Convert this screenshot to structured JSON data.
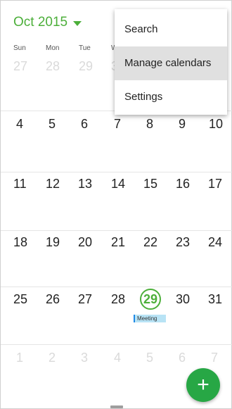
{
  "header": {
    "month": "Oct 2015"
  },
  "weekdays": [
    "Sun",
    "Mon",
    "Tue",
    "W"
  ],
  "weeks": [
    [
      "27",
      "28",
      "29",
      "3",
      "",
      "",
      ""
    ],
    [
      "4",
      "5",
      "6",
      "7",
      "8",
      "9",
      "10"
    ],
    [
      "11",
      "12",
      "13",
      "14",
      "15",
      "16",
      "17"
    ],
    [
      "18",
      "19",
      "20",
      "21",
      "22",
      "23",
      "24"
    ],
    [
      "25",
      "26",
      "27",
      "28",
      "29",
      "30",
      "31"
    ],
    [
      "1",
      "2",
      "3",
      "4",
      "5",
      "6",
      "7"
    ]
  ],
  "event": {
    "label": "Meeting"
  },
  "menu": {
    "items": [
      "Search",
      "Manage calendars",
      "Settings"
    ]
  },
  "fab": {
    "icon": "+"
  },
  "colors": {
    "accent": "#4caf3a",
    "event_bg": "#b8e3f5",
    "fab": "#27a745"
  }
}
